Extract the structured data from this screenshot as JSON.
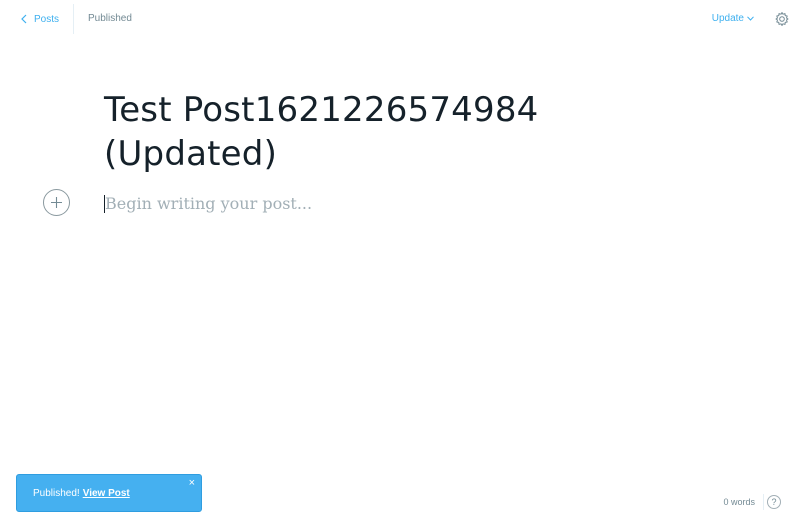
{
  "header": {
    "back_label": "Posts",
    "status": "Published",
    "update_label": "Update"
  },
  "editor": {
    "title_line1": "Test Post1621226574984",
    "title_line2": "(Updated)",
    "body_placeholder": "Begin writing your post..."
  },
  "footer": {
    "word_count": "0 words",
    "help_label": "?"
  },
  "notification": {
    "message": "Published!",
    "link_label": "View Post",
    "close_label": "×"
  },
  "colors": {
    "accent": "#3eb0ef",
    "notification_bg": "#45b0f0",
    "text": "#15212a",
    "muted": "#738a94"
  },
  "icons": {
    "back": "chevron-left-icon",
    "update": "chevron-down-icon",
    "settings": "gear-icon",
    "add": "plus-icon",
    "close": "close-icon",
    "help": "question-icon"
  }
}
